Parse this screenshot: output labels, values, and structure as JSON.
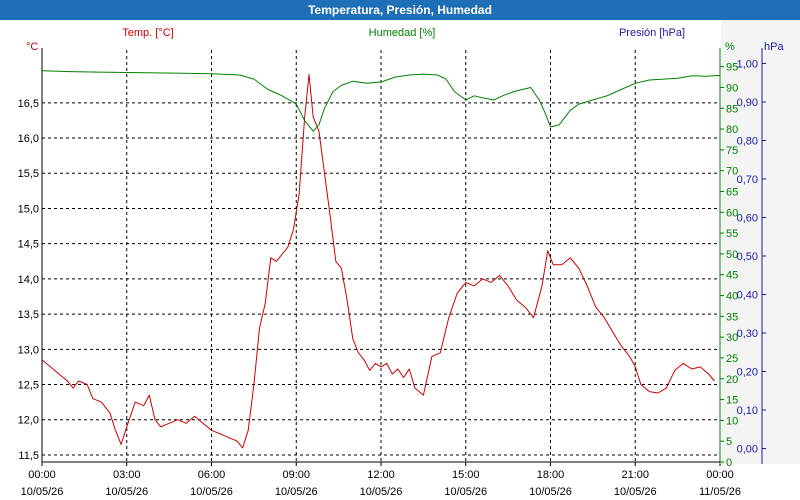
{
  "window": {
    "title": "Temperatura, Presión, Humedad"
  },
  "colors": {
    "temperature": "#cc0000",
    "humidity": "#008000",
    "pressure": "#1a1aa8",
    "titlebar": "#1f6fb8",
    "grid": "#000000"
  },
  "chart_data": {
    "type": "line",
    "grid": true,
    "legend": "none",
    "x_axis": {
      "ticks": [
        {
          "time": "00:00",
          "date": "10/05/26"
        },
        {
          "time": "03:00",
          "date": "10/05/26"
        },
        {
          "time": "06:00",
          "date": "10/05/26"
        },
        {
          "time": "09:00",
          "date": "10/05/26"
        },
        {
          "time": "12:00",
          "date": "10/05/26"
        },
        {
          "time": "15:00",
          "date": "10/05/26"
        },
        {
          "time": "18:00",
          "date": "10/05/26"
        },
        {
          "time": "21:00",
          "date": "10/05/26"
        },
        {
          "time": "00:00",
          "date": "11/05/26"
        }
      ],
      "range_hours": [
        0,
        24
      ]
    },
    "axes": {
      "temperature": {
        "label": "Temp. [°C]",
        "unit": "°C",
        "range": [
          11.4,
          17.25
        ],
        "ticks": [
          "11,5",
          "12,0",
          "12,5",
          "13,0",
          "13,5",
          "14,0",
          "14,5",
          "15,0",
          "15,5",
          "16,0",
          "16,5"
        ],
        "tick_values": [
          11.5,
          12.0,
          12.5,
          13.0,
          13.5,
          14.0,
          14.5,
          15.0,
          15.5,
          16.0,
          16.5
        ]
      },
      "humidity": {
        "label": "Humedad [%]",
        "unit": "%",
        "range": [
          0,
          99
        ],
        "ticks": [
          "0",
          "5",
          "10",
          "15",
          "20",
          "25",
          "30",
          "35",
          "40",
          "45",
          "50",
          "55",
          "60",
          "65",
          "70",
          "75",
          "80",
          "85",
          "90",
          "95"
        ],
        "tick_values": [
          0,
          5,
          10,
          15,
          20,
          25,
          30,
          35,
          40,
          45,
          50,
          55,
          60,
          65,
          70,
          75,
          80,
          85,
          90,
          95
        ]
      },
      "pressure": {
        "label": "Presión [hPa]",
        "unit": "hPa",
        "range": [
          -0.035,
          1.035
        ],
        "ticks": [
          "0,00",
          "0,10",
          "0,20",
          "0,30",
          "0,40",
          "0,50",
          "0,60",
          "0,70",
          "0,80",
          "0,90",
          "1,00"
        ],
        "tick_values": [
          0.0,
          0.1,
          0.2,
          0.3,
          0.4,
          0.5,
          0.6,
          0.7,
          0.8,
          0.9,
          1.0
        ]
      }
    },
    "series": [
      {
        "name": "Temp. [°C]",
        "axis": "temperature",
        "color": "#cc0000",
        "points": [
          [
            0.0,
            12.85
          ],
          [
            0.3,
            12.75
          ],
          [
            0.6,
            12.65
          ],
          [
            0.9,
            12.55
          ],
          [
            1.1,
            12.45
          ],
          [
            1.3,
            12.55
          ],
          [
            1.6,
            12.5
          ],
          [
            1.8,
            12.3
          ],
          [
            2.1,
            12.25
          ],
          [
            2.4,
            12.1
          ],
          [
            2.6,
            11.85
          ],
          [
            2.8,
            11.65
          ],
          [
            3.0,
            11.9
          ],
          [
            3.3,
            12.25
          ],
          [
            3.6,
            12.2
          ],
          [
            3.8,
            12.35
          ],
          [
            4.0,
            12.0
          ],
          [
            4.2,
            11.9
          ],
          [
            4.5,
            11.95
          ],
          [
            4.8,
            12.0
          ],
          [
            5.1,
            11.95
          ],
          [
            5.4,
            12.05
          ],
          [
            5.7,
            11.95
          ],
          [
            6.0,
            11.85
          ],
          [
            6.3,
            11.8
          ],
          [
            6.6,
            11.75
          ],
          [
            6.9,
            11.7
          ],
          [
            7.1,
            11.6
          ],
          [
            7.3,
            11.85
          ],
          [
            7.5,
            12.5
          ],
          [
            7.7,
            13.3
          ],
          [
            7.9,
            13.65
          ],
          [
            8.1,
            14.3
          ],
          [
            8.3,
            14.25
          ],
          [
            8.5,
            14.35
          ],
          [
            8.7,
            14.45
          ],
          [
            8.9,
            14.7
          ],
          [
            9.1,
            15.2
          ],
          [
            9.3,
            16.3
          ],
          [
            9.45,
            16.9
          ],
          [
            9.6,
            16.3
          ],
          [
            9.8,
            16.1
          ],
          [
            10.0,
            15.5
          ],
          [
            10.2,
            14.9
          ],
          [
            10.4,
            14.25
          ],
          [
            10.6,
            14.15
          ],
          [
            10.8,
            13.7
          ],
          [
            11.0,
            13.15
          ],
          [
            11.2,
            12.95
          ],
          [
            11.4,
            12.85
          ],
          [
            11.6,
            12.7
          ],
          [
            11.8,
            12.8
          ],
          [
            12.0,
            12.75
          ],
          [
            12.2,
            12.8
          ],
          [
            12.4,
            12.65
          ],
          [
            12.6,
            12.72
          ],
          [
            12.8,
            12.6
          ],
          [
            13.0,
            12.72
          ],
          [
            13.2,
            12.45
          ],
          [
            13.5,
            12.35
          ],
          [
            13.8,
            12.9
          ],
          [
            14.1,
            12.95
          ],
          [
            14.4,
            13.45
          ],
          [
            14.7,
            13.8
          ],
          [
            15.0,
            13.95
          ],
          [
            15.3,
            13.9
          ],
          [
            15.6,
            14.0
          ],
          [
            15.9,
            13.95
          ],
          [
            16.2,
            14.05
          ],
          [
            16.5,
            13.9
          ],
          [
            16.8,
            13.7
          ],
          [
            17.1,
            13.6
          ],
          [
            17.4,
            13.45
          ],
          [
            17.7,
            13.9
          ],
          [
            17.9,
            14.4
          ],
          [
            18.1,
            14.2
          ],
          [
            18.4,
            14.2
          ],
          [
            18.7,
            14.3
          ],
          [
            19.0,
            14.15
          ],
          [
            19.3,
            13.9
          ],
          [
            19.6,
            13.6
          ],
          [
            19.9,
            13.45
          ],
          [
            20.2,
            13.25
          ],
          [
            20.5,
            13.05
          ],
          [
            20.8,
            12.9
          ],
          [
            21.0,
            12.75
          ],
          [
            21.2,
            12.5
          ],
          [
            21.5,
            12.4
          ],
          [
            21.8,
            12.38
          ],
          [
            22.1,
            12.45
          ],
          [
            22.4,
            12.7
          ],
          [
            22.7,
            12.8
          ],
          [
            23.0,
            12.72
          ],
          [
            23.3,
            12.75
          ],
          [
            23.6,
            12.65
          ],
          [
            23.8,
            12.55
          ]
        ]
      },
      {
        "name": "Humedad [%]",
        "axis": "humidity",
        "color": "#008000",
        "points": [
          [
            0.0,
            94.0
          ],
          [
            1.0,
            93.8
          ],
          [
            2.0,
            93.7
          ],
          [
            3.0,
            93.6
          ],
          [
            4.0,
            93.5
          ],
          [
            5.0,
            93.4
          ],
          [
            6.0,
            93.3
          ],
          [
            7.0,
            93.0
          ],
          [
            7.5,
            92.0
          ],
          [
            8.0,
            89.5
          ],
          [
            8.5,
            88.0
          ],
          [
            9.0,
            86.0
          ],
          [
            9.3,
            82.0
          ],
          [
            9.6,
            79.5
          ],
          [
            9.8,
            81.0
          ],
          [
            10.0,
            85.0
          ],
          [
            10.3,
            89.0
          ],
          [
            10.6,
            90.5
          ],
          [
            11.0,
            91.5
          ],
          [
            11.5,
            91.0
          ],
          [
            12.0,
            91.3
          ],
          [
            12.5,
            92.5
          ],
          [
            13.0,
            93.0
          ],
          [
            13.5,
            93.2
          ],
          [
            14.0,
            93.0
          ],
          [
            14.3,
            92.0
          ],
          [
            14.6,
            89.0
          ],
          [
            15.0,
            87.0
          ],
          [
            15.3,
            88.0
          ],
          [
            15.6,
            87.5
          ],
          [
            16.0,
            87.0
          ],
          [
            16.3,
            88.0
          ],
          [
            16.7,
            89.0
          ],
          [
            17.0,
            89.5
          ],
          [
            17.3,
            90.0
          ],
          [
            17.6,
            87.0
          ],
          [
            17.8,
            84.0
          ],
          [
            18.0,
            80.5
          ],
          [
            18.3,
            81.0
          ],
          [
            18.7,
            84.5
          ],
          [
            19.0,
            86.0
          ],
          [
            19.5,
            87.0
          ],
          [
            20.0,
            88.0
          ],
          [
            20.5,
            89.5
          ],
          [
            21.0,
            91.0
          ],
          [
            21.5,
            91.8
          ],
          [
            22.0,
            92.0
          ],
          [
            22.5,
            92.2
          ],
          [
            23.0,
            92.8
          ],
          [
            23.5,
            92.7
          ],
          [
            24.0,
            92.9
          ]
        ]
      }
    ]
  }
}
